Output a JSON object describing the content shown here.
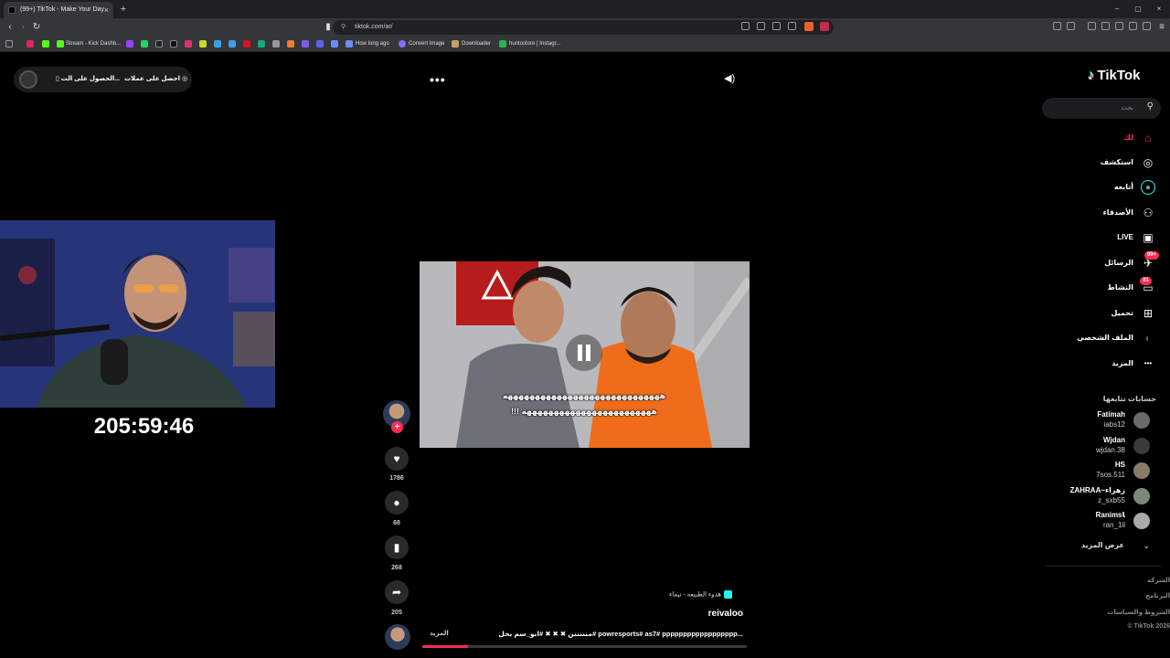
{
  "browser": {
    "tab_title": "(99+) TikTok - Make Your Day",
    "tab_close": "×",
    "new_tab": "+",
    "url": "tiktok.com/ar/",
    "window_controls": [
      "–",
      "▢",
      "×"
    ],
    "bookmarks": [
      "Stream - Kick Dashb...",
      "How long ago",
      "Convert Image",
      "Downloader",
      "huntostore | Instagr..."
    ]
  },
  "app_pill": {
    "get_coins": "احصل على عملات",
    "get_app": "الحصول على الت..."
  },
  "top_controls": {
    "more": "•••",
    "volume": "◀)"
  },
  "stream_overlay": {
    "timer": "205:59:46"
  },
  "video": {
    "caption_line1": "هههههههههههههههههههههههههههههه",
    "caption_line2": "!!! ههههههههههههههههههههههههه",
    "sound": "هدوء الطبيعه - تيماء",
    "author": "reivaloo",
    "description": "منننننن ✖ ✖ ✖ #ابو_سم بحل# powresports# as7# pppppppppppppppppp...",
    "more": "المزيد",
    "progress": 0.14
  },
  "actions": {
    "likes": "1786",
    "comments": "68",
    "saves": "268",
    "shares": "205"
  },
  "sidebar": {
    "logo": "TikTok",
    "search_placeholder": "بحث",
    "nav": [
      {
        "label": "لك",
        "icon": "home-icon",
        "glyph": "⌂"
      },
      {
        "label": "استكشف",
        "icon": "compass-icon",
        "glyph": "◎"
      },
      {
        "label": "أتابعه",
        "icon": "following-avatar-icon",
        "glyph": "●"
      },
      {
        "label": "الأصدقاء",
        "icon": "friends-icon",
        "glyph": "⚇"
      },
      {
        "label": "LIVE",
        "icon": "live-icon",
        "glyph": "▣"
      },
      {
        "label": "الرسائل",
        "icon": "messages-icon",
        "glyph": "✈",
        "badge": "99+"
      },
      {
        "label": "النشاط",
        "icon": "activity-icon",
        "glyph": "▭",
        "badge": "81"
      },
      {
        "label": "تحميل",
        "icon": "upload-icon",
        "glyph": "⊞"
      },
      {
        "label": "الملف الشخصي",
        "icon": "profile-icon",
        "glyph": "◐"
      },
      {
        "label": "المزيد",
        "icon": "more-icon",
        "glyph": "•••"
      }
    ],
    "following_header": "حسابات تتابعها",
    "following": [
      {
        "name": "Fatimah",
        "username": "iabs12"
      },
      {
        "name": "Wjdan",
        "username": "wjdan.38"
      },
      {
        "name": "HS",
        "username": "7sos.511"
      },
      {
        "name": "ZAHRAA~زهراء",
        "username": "z_sxb55"
      },
      {
        "name": "RanimsꙆ",
        "username": "ran_1il"
      }
    ],
    "see_more": "عرض المزيد",
    "footer": [
      "الشركة",
      "البرنامج",
      "الشروط والسياسات",
      "© TikTok 2026"
    ],
    "colors": {
      "accent": "#fe2c55",
      "cyan": "#25f4ee"
    }
  }
}
